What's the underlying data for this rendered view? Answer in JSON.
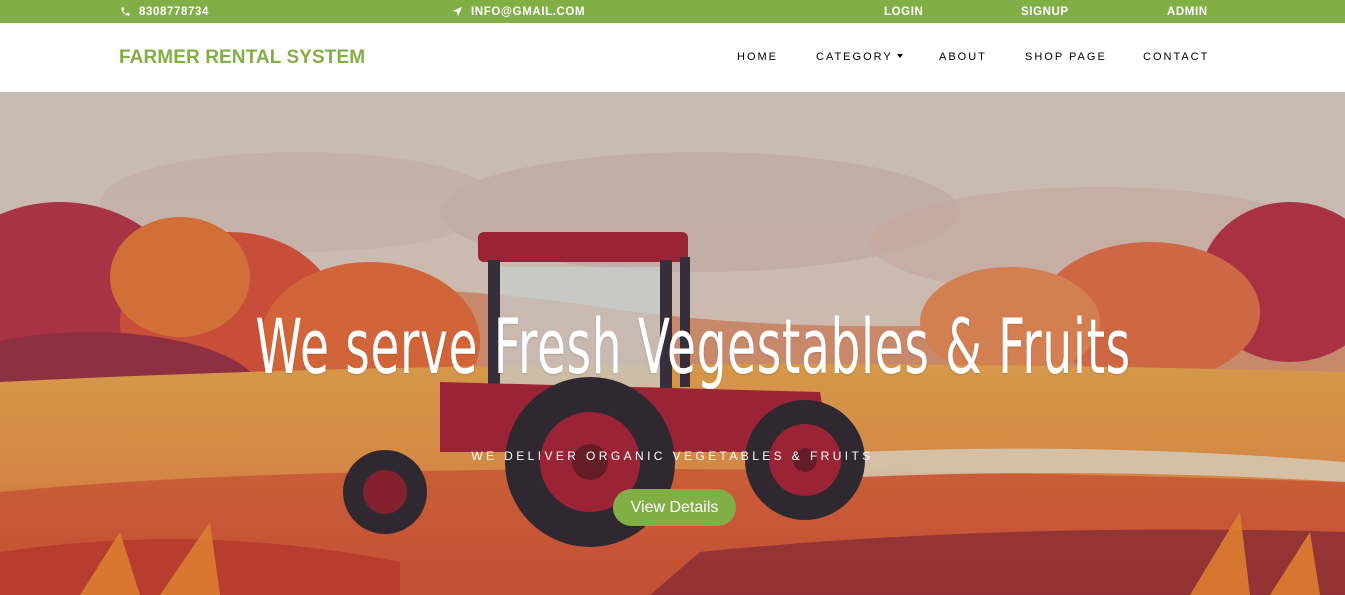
{
  "topbar": {
    "phone": "8308778734",
    "email": "INFO@GMAIL.COM",
    "login": "LOGIN",
    "signup": "SIGNUP",
    "admin": "ADMIN"
  },
  "navbar": {
    "brand": "FARMER RENTAL SYSTEM",
    "items": [
      "HOME",
      "CATEGORY",
      "ABOUT",
      "SHOP PAGE",
      "CONTACT"
    ]
  },
  "hero": {
    "title": "We serve Fresh Vegestables & Fruits",
    "subtitle": "WE DELIVER ORGANIC VEGETABLES & FRUITS",
    "button": "View Details"
  },
  "colors": {
    "accent": "#82ae46",
    "text": "#000000",
    "white": "#ffffff"
  },
  "icons": {
    "phone": "phone-icon",
    "email": "paper-plane-icon",
    "caret": "caret-down-icon"
  }
}
